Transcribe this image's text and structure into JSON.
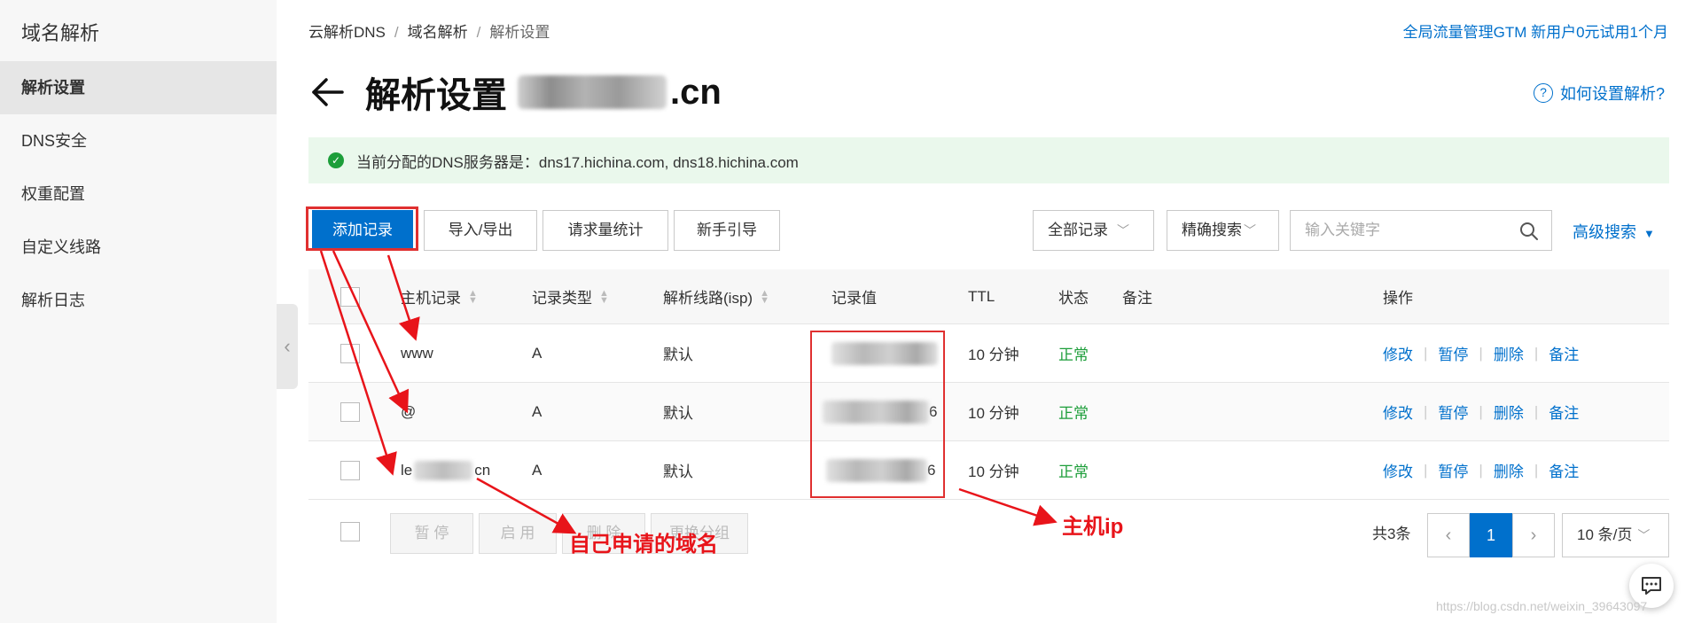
{
  "sidebar": {
    "title": "域名解析",
    "items": [
      {
        "label": "解析设置",
        "active": true
      },
      {
        "label": "DNS安全"
      },
      {
        "label": "权重配置"
      },
      {
        "label": "自定义线路"
      },
      {
        "label": "解析日志"
      }
    ]
  },
  "breadcrumb": [
    "云解析DNS",
    "域名解析",
    "解析设置"
  ],
  "promo": "全局流量管理GTM 新用户0元试用1个月",
  "page": {
    "title": "解析设置",
    "domain_suffix": ".cn",
    "help": "如何设置解析?"
  },
  "notice": "当前分配的DNS服务器是：dns17.hichina.com, dns18.hichina.com",
  "toolbar": {
    "add": "添加记录",
    "import_export": "导入/导出",
    "stats": "请求量统计",
    "guide": "新手引导",
    "filter_select": "全部记录",
    "search_mode": "精确搜索",
    "search_placeholder": "输入关键字",
    "advanced": "高级搜索"
  },
  "table": {
    "headers": {
      "host": "主机记录",
      "type": "记录类型",
      "line": "解析线路(isp)",
      "value": "记录值",
      "ttl": "TTL",
      "status": "状态",
      "remark": "备注",
      "ops": "操作"
    },
    "rows": [
      {
        "host": "www",
        "type": "A",
        "line": "默认",
        "value_tail": "",
        "ttl": "10 分钟",
        "status": "正常"
      },
      {
        "host": "@",
        "type": "A",
        "line": "默认",
        "value_tail": "6",
        "ttl": "10 分钟",
        "status": "正常"
      },
      {
        "host_prefix": "le",
        "host_suffix": "cn",
        "type": "A",
        "line": "默认",
        "value_tail": "6",
        "ttl": "10 分钟",
        "status": "正常"
      }
    ],
    "ops": [
      "修改",
      "暂停",
      "删除",
      "备注"
    ]
  },
  "footer": {
    "pause": "暂 停",
    "enable": "启 用",
    "delete": "删 除",
    "group": "更换分组",
    "total": "共3条",
    "current_page": "1",
    "page_size": "10 条/页"
  },
  "annotations": {
    "domain_label": "自己申请的域名",
    "ip_label": "主机ip"
  },
  "watermark": "https://blog.csdn.net/weixin_39643097",
  "colors": {
    "primary": "#0070cc",
    "success": "#1d9e3a",
    "annotation": "#e8141a",
    "notice_bg": "#eaf8ec"
  }
}
